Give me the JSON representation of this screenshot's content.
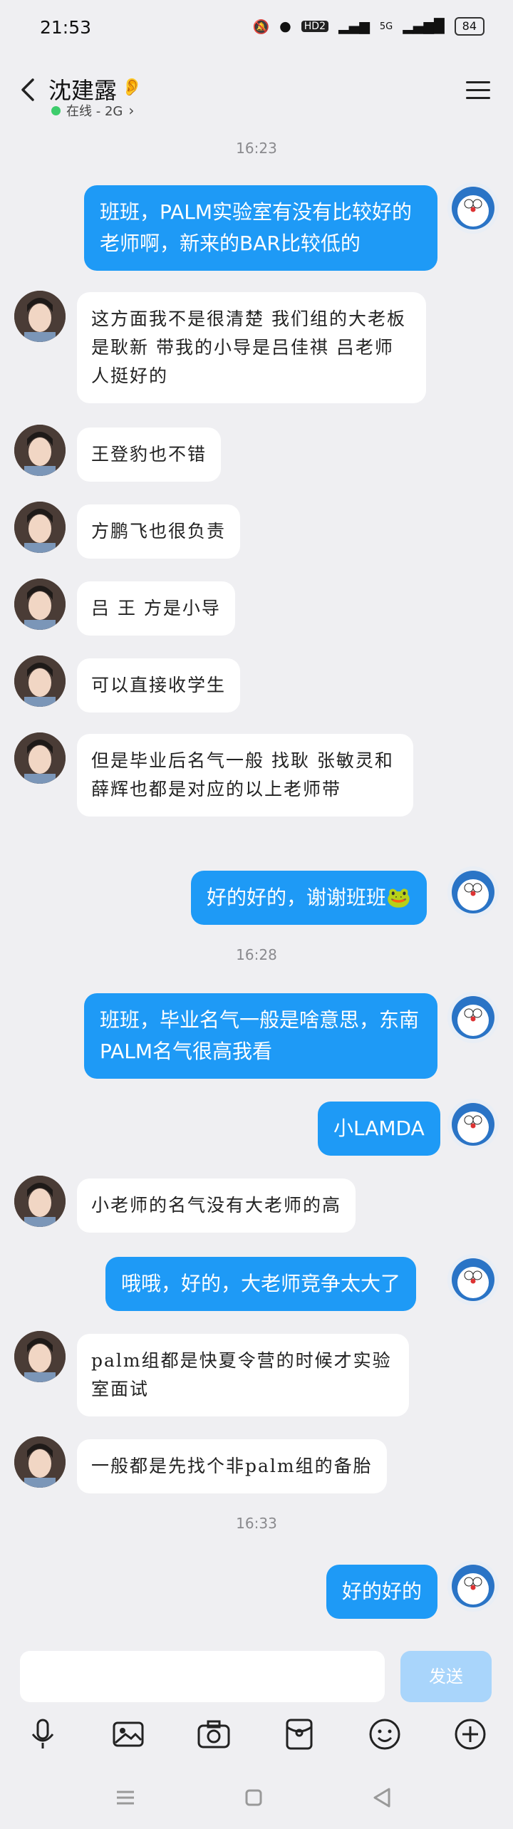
{
  "status": {
    "time": "21:53",
    "network_badge": "HD2",
    "signal_text": "5G",
    "battery": "84"
  },
  "header": {
    "name": "沈建露",
    "presence": "在线 - 2G"
  },
  "timestamps": [
    "16:23",
    "16:28",
    "16:33"
  ],
  "messages": [
    {
      "text": "班班，PALM实验室有没有比较好的老师啊，新来的BAR比较低的"
    },
    {
      "text": "这方面我不是很清楚  我们组的大老板是耿新  带我的小导是吕佳祺  吕老师人挺好的"
    },
    {
      "text": "王登豹也不错"
    },
    {
      "text": "方鹏飞也很负责"
    },
    {
      "text": "吕 王 方是小导"
    },
    {
      "text": "可以直接收学生"
    },
    {
      "text": "但是毕业后名气一般  找耿 张敏灵和薛辉也都是对应的以上老师带"
    },
    {
      "text": "好的好的，谢谢班班🐸"
    },
    {
      "text": "班班，毕业名气一般是啥意思，东南PALM名气很高我看"
    },
    {
      "text": "小LAMDA"
    },
    {
      "text": "小老师的名气没有大老师的高"
    },
    {
      "text": "哦哦，好的，大老师竞争太大了"
    },
    {
      "text": "palm组都是快夏令营的时候才实验室面试"
    },
    {
      "text": "一般都是先找个非palm组的备胎"
    },
    {
      "text": "好的好的"
    }
  ],
  "composer": {
    "send_label": "发送"
  },
  "icons": [
    "mic-icon",
    "image-icon",
    "camera-icon",
    "red-packet-icon",
    "emoji-icon",
    "plus-icon"
  ],
  "colors": {
    "outgoing": "#1e9af6",
    "send_disabled": "#a9d5fb",
    "online": "#3dcc6c"
  }
}
